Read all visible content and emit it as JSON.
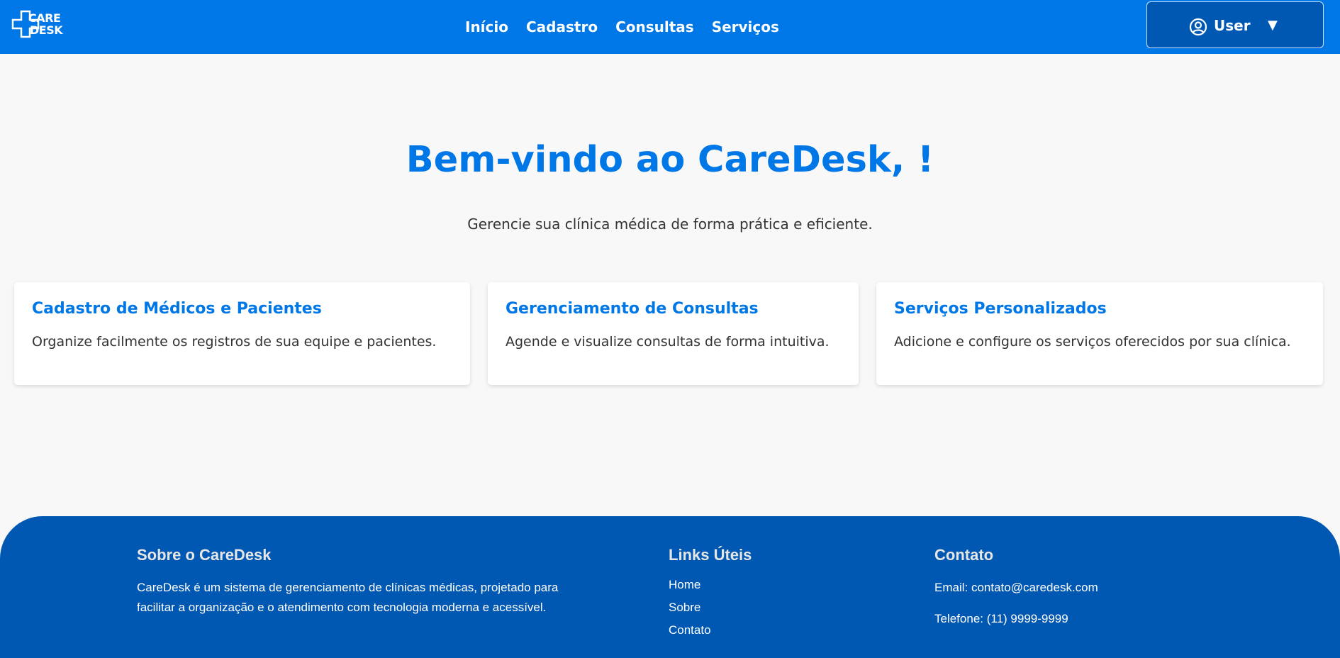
{
  "brand": {
    "logo_line1": "CARE",
    "logo_line2": "DESK"
  },
  "nav": {
    "items": [
      {
        "label": "Início"
      },
      {
        "label": "Cadastro"
      },
      {
        "label": "Consultas"
      },
      {
        "label": "Serviços"
      }
    ]
  },
  "user_menu": {
    "label": "User",
    "caret": "▼",
    "icon": "user-circle-icon"
  },
  "hero": {
    "title": "Bem-vindo ao CareDesk, !",
    "subtitle": "Gerencie sua clínica médica de forma prática e eficiente."
  },
  "cards": [
    {
      "title": "Cadastro de Médicos e Pacientes",
      "text": "Organize facilmente os registros de sua equipe e pacientes."
    },
    {
      "title": "Gerenciamento de Consultas",
      "text": "Agende e visualize consultas de forma intuitiva."
    },
    {
      "title": "Serviços Personalizados",
      "text": "Adicione e configure os serviços oferecidos por sua clínica."
    }
  ],
  "footer": {
    "about": {
      "title": "Sobre o CareDesk",
      "text": "CareDesk é um sistema de gerenciamento de clínicas médicas, projetado para facilitar a organização e o atendimento com tecnologia moderna e acessível."
    },
    "links": {
      "title": "Links Úteis",
      "items": [
        "Home",
        "Sobre",
        "Contato"
      ]
    },
    "contact": {
      "title": "Contato",
      "email": "Email: contato@caredesk.com",
      "phone": "Telefone: (11) 9999-9999"
    }
  },
  "colors": {
    "header_bg": "#0077e6",
    "footer_bg": "#0058b3",
    "accent": "#0077e6",
    "page_bg": "#f8f8f8"
  }
}
